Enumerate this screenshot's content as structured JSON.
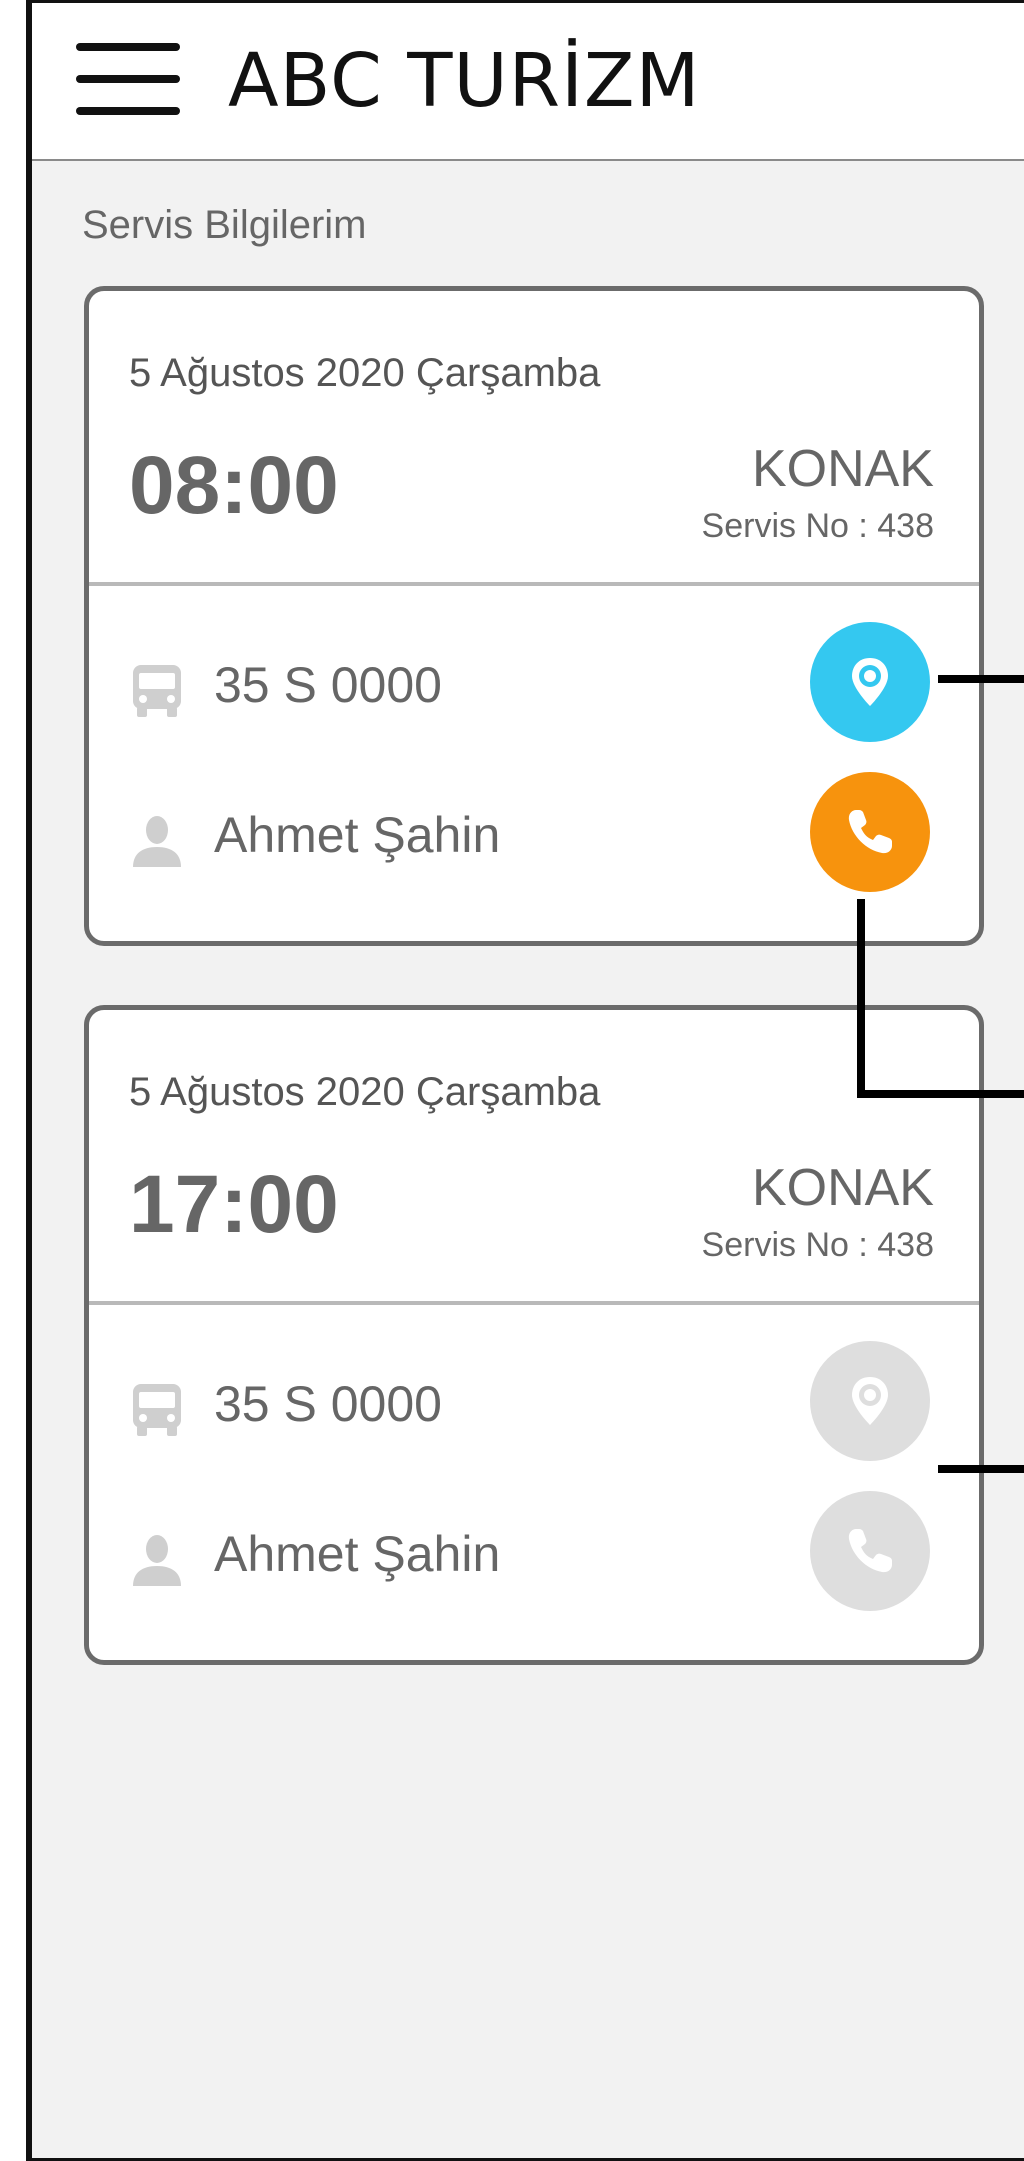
{
  "header": {
    "title": "ABC TURİZM",
    "menu_icon": "hamburger-menu-icon"
  },
  "section_title": "Servis Bilgilerim",
  "cards": [
    {
      "date": "5 Ağustos 2020 Çarşamba",
      "time": "08:00",
      "district": "KONAK",
      "service_no": "Servis No : 438",
      "plate": "35 S 0000",
      "driver": "Ahmet Şahin",
      "location_enabled": true,
      "call_enabled": true
    },
    {
      "date": "5 Ağustos 2020 Çarşamba",
      "time": "17:00",
      "district": "KONAK",
      "service_no": "Servis No : 438",
      "plate": "35 S 0000",
      "driver": "Ahmet Şahin",
      "location_enabled": false,
      "call_enabled": false
    }
  ],
  "colors": {
    "location_active": "#34c8f0",
    "call_active": "#f7930d",
    "disabled": "#dedede",
    "icon_gray": "#cfcfcf"
  }
}
